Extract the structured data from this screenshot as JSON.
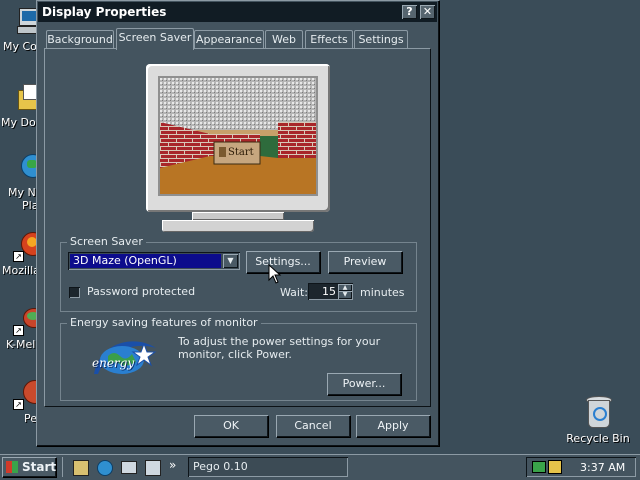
{
  "desktop": {
    "icons": [
      {
        "label": "My Co",
        "icon": "my-computer-icon"
      },
      {
        "label": "My Doc",
        "icon": "my-documents-icon"
      },
      {
        "label": "My Ne",
        "label2": "Pla",
        "icon": "network-places-icon"
      },
      {
        "label": "Mozilla",
        "icon": "mozilla-icon"
      },
      {
        "label": "K-Mele",
        "icon": "k-meleon-icon"
      },
      {
        "label": "Pe",
        "icon": "pego-icon"
      }
    ],
    "recycle_bin_label": "Recycle Bin"
  },
  "dialog": {
    "title": "Display Properties",
    "help_button": "?",
    "close_button": "✕",
    "tabs": [
      {
        "label": "Background",
        "active": false
      },
      {
        "label": "Screen Saver",
        "active": true
      },
      {
        "label": "Appearance",
        "active": false
      },
      {
        "label": "Web",
        "active": false
      },
      {
        "label": "Effects",
        "active": false
      },
      {
        "label": "Settings",
        "active": false
      }
    ],
    "preview": {
      "start_label": "Start"
    },
    "screensaver": {
      "group_title": "Screen Saver",
      "selected": "3D Maze (OpenGL)",
      "settings_button": "Settings...",
      "preview_button": "Preview",
      "password_label": "Password protected",
      "password_checked": false,
      "wait_label": "Wait:",
      "wait_value": "15",
      "wait_units": "minutes"
    },
    "energy": {
      "group_title": "Energy saving features of monitor",
      "description": "To adjust the power settings for your monitor, click Power.",
      "power_button": "Power...",
      "logo_text": "energy"
    },
    "buttons": {
      "ok": "OK",
      "cancel": "Cancel",
      "apply": "Apply"
    }
  },
  "taskbar": {
    "start_label": "Start",
    "quick_launch": [
      "desktop-icon",
      "browser-icon",
      "mail-icon",
      "search-icon"
    ],
    "overflow": "»",
    "task_label": "Pego 0.10",
    "clock": "3:37 AM"
  },
  "colors": {
    "desktop": "#3a4c58",
    "dialog_face": "#44545f",
    "titlebar": "#111c24",
    "combo_selected": "#0c0c8c"
  }
}
